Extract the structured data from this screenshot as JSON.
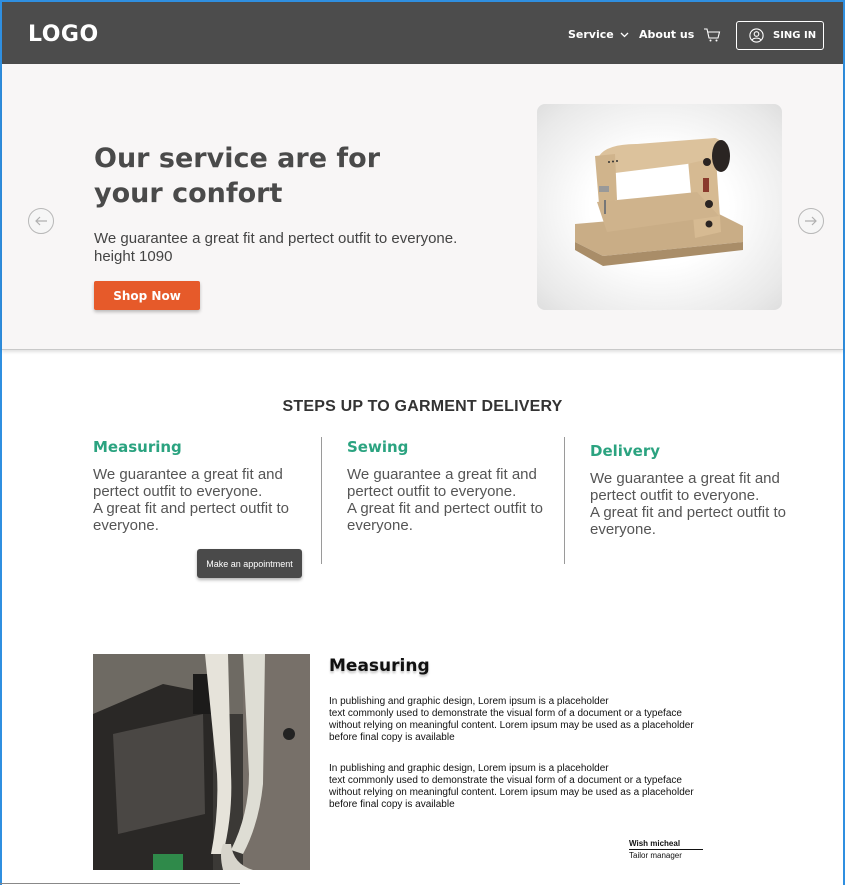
{
  "navbar": {
    "logo": "LOGO",
    "service_label": "Service",
    "about_label": "About us",
    "signin_label": "SING IN",
    "icons": [
      "chevron-down-icon",
      "cart-icon",
      "user-circle-icon"
    ]
  },
  "hero": {
    "title": "Our service are for\nyour  confort",
    "description": "We guarantee a great  fit and pertect outfit to everyone.\nheight 1090",
    "cta_label": "Shop Now",
    "image_alt": "sewing machine",
    "colors": {
      "cta": "#e65a2a",
      "background": "#f8f6f6"
    }
  },
  "steps": {
    "heading": "STEPS UP TO  GARMENT DELIVERY",
    "items": [
      {
        "title": "Measuring",
        "text": "We guarantee a great  fit and\npertect outfit to everyone.\nA great  fit and pertect outfit to\neveryone."
      },
      {
        "title": "Sewing",
        "text": "We guarantee a great  fit and\npertect outfit to everyone.\nA great  fit and pertect outfit to\neveryone."
      },
      {
        "title": "Delivery",
        "text": "We guarantee a great  fit and\npertect outfit to everyone.\nA great  fit and pertect outfit to\neveryone."
      }
    ],
    "appointment_label": "Make an appointment",
    "accent_color": "#2ba380"
  },
  "feature": {
    "title": "Measuring",
    "paragraphs": [
      "In publishing and graphic design, Lorem ipsum is a placeholder\ntext commonly used to demonstrate the visual form of a document or a typeface\nwithout relying on meaningful content. Lorem ipsum may be used as a placeholder\nbefore final copy is available",
      "In publishing and graphic design, Lorem ipsum is a placeholder\ntext commonly used to demonstrate the visual form of a document or a typeface\nwithout relying on meaningful content. Lorem ipsum may be used as a placeholder\nbefore final copy is available"
    ],
    "signature_name": "Wish micheal",
    "signature_role": "Tailor manager"
  }
}
